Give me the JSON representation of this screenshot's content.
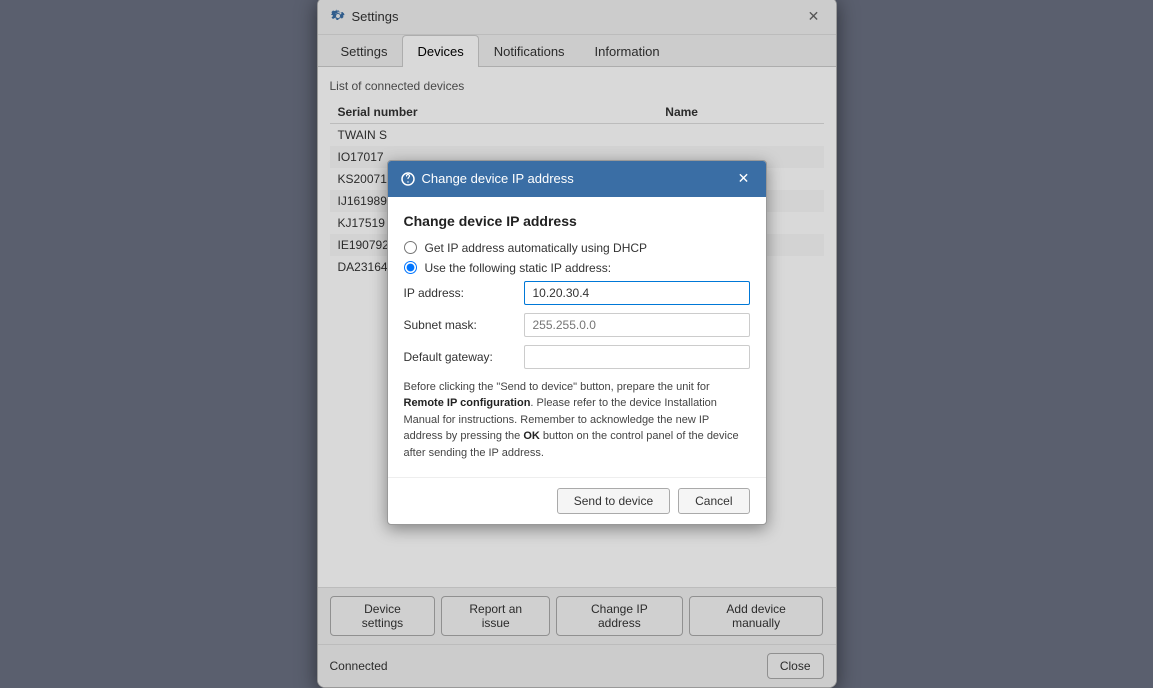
{
  "window": {
    "title": "Settings",
    "close_label": "✕"
  },
  "tabs": [
    {
      "id": "settings",
      "label": "Settings",
      "active": false
    },
    {
      "id": "devices",
      "label": "Devices",
      "active": true
    },
    {
      "id": "notifications",
      "label": "Notifications",
      "active": false
    },
    {
      "id": "information",
      "label": "Information",
      "active": false
    }
  ],
  "devices_section": {
    "section_title": "List of connected devices",
    "table_headers": [
      "Serial number",
      "Name"
    ],
    "rows": [
      {
        "serial": "TWAIN S",
        "name": ""
      },
      {
        "serial": "IO17017",
        "name": ""
      },
      {
        "serial": "KS20071",
        "name": ""
      },
      {
        "serial": "IJ161989",
        "name": ""
      },
      {
        "serial": "KJ17519",
        "name": ""
      },
      {
        "serial": "IE190792",
        "name": ""
      },
      {
        "serial": "DA23164",
        "name": ""
      }
    ]
  },
  "action_buttons": [
    {
      "id": "device-settings",
      "label": "Device settings"
    },
    {
      "id": "report-issue",
      "label": "Report an issue"
    },
    {
      "id": "change-ip",
      "label": "Change IP address"
    },
    {
      "id": "add-device",
      "label": "Add device manually"
    }
  ],
  "status": {
    "text": "Connected"
  },
  "close_button": "Close",
  "dialog": {
    "title": "Change device IP address",
    "heading": "Change device IP address",
    "close_label": "✕",
    "radio_dhcp": "Get IP address automatically using DHCP",
    "radio_static": "Use the following static IP address:",
    "fields": [
      {
        "id": "ip-address",
        "label": "IP address:",
        "value": "10.20.30.4",
        "placeholder": ""
      },
      {
        "id": "subnet-mask",
        "label": "Subnet mask:",
        "value": "",
        "placeholder": "255.255.0.0"
      },
      {
        "id": "default-gateway",
        "label": "Default gateway:",
        "value": "",
        "placeholder": ""
      }
    ],
    "info_text_before": "Before clicking the \"Send to device\" button, prepare the unit for ",
    "info_text_bold1": "Remote IP configuration",
    "info_text_middle": ". Please refer to the device Installation Manual for instructions. Remember to acknowledge the new IP address by pressing the ",
    "info_text_bold2": "OK",
    "info_text_after": " button on the control panel of the device after sending the IP address.",
    "send_button": "Send to device",
    "cancel_button": "Cancel"
  }
}
